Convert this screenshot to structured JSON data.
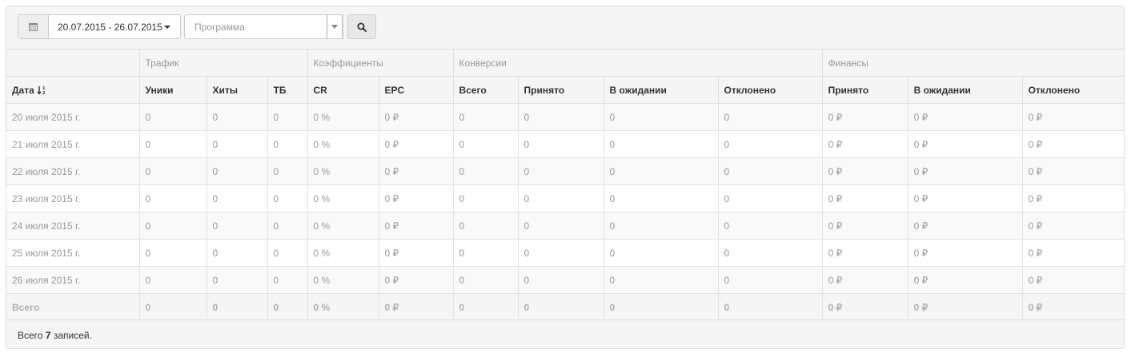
{
  "filters": {
    "date_range": "20.07.2015 - 26.07.2015",
    "program_placeholder": "Программа"
  },
  "icons": {
    "calendar": "calendar-icon",
    "date_caret": "caret-down-icon",
    "program_arrow": "chevron-down-icon",
    "search": "search-icon",
    "sort": "sort-numeric-asc-icon"
  },
  "table": {
    "groups": [
      "Трафик",
      "Коэффициенты",
      "Конверсии",
      "Финансы"
    ],
    "columns": [
      "Дата",
      "Уники",
      "Хиты",
      "ТБ",
      "CR",
      "EPC",
      "Всего",
      "Принято",
      "В ожидании",
      "Отклонено",
      "Принято",
      "В ожидании",
      "Отклонено"
    ],
    "rows": [
      [
        "20 июля 2015 г.",
        "0",
        "0",
        "0",
        "0 %",
        "0 ₽",
        "0",
        "0",
        "0",
        "0",
        "0 ₽",
        "0 ₽",
        "0 ₽"
      ],
      [
        "21 июля 2015 г.",
        "0",
        "0",
        "0",
        "0 %",
        "0 ₽",
        "0",
        "0",
        "0",
        "0",
        "0 ₽",
        "0 ₽",
        "0 ₽"
      ],
      [
        "22 июля 2015 г.",
        "0",
        "0",
        "0",
        "0 %",
        "0 ₽",
        "0",
        "0",
        "0",
        "0",
        "0 ₽",
        "0 ₽",
        "0 ₽"
      ],
      [
        "23 июля 2015 г.",
        "0",
        "0",
        "0",
        "0 %",
        "0 ₽",
        "0",
        "0",
        "0",
        "0",
        "0 ₽",
        "0 ₽",
        "0 ₽"
      ],
      [
        "24 июля 2015 г.",
        "0",
        "0",
        "0",
        "0 %",
        "0 ₽",
        "0",
        "0",
        "0",
        "0",
        "0 ₽",
        "0 ₽",
        "0 ₽"
      ],
      [
        "25 июля 2015 г.",
        "0",
        "0",
        "0",
        "0 %",
        "0 ₽",
        "0",
        "0",
        "0",
        "0",
        "0 ₽",
        "0 ₽",
        "0 ₽"
      ],
      [
        "26 июля 2015 г.",
        "0",
        "0",
        "0",
        "0 %",
        "0 ₽",
        "0",
        "0",
        "0",
        "0",
        "0 ₽",
        "0 ₽",
        "0 ₽"
      ]
    ],
    "total": [
      "Всего",
      "0",
      "0",
      "0",
      "0 %",
      "0 ₽",
      "0",
      "0",
      "0",
      "0",
      "0 ₽",
      "0 ₽",
      "0 ₽"
    ]
  },
  "footer": {
    "prefix": "Всего",
    "count": "7",
    "suffix": "записей."
  }
}
